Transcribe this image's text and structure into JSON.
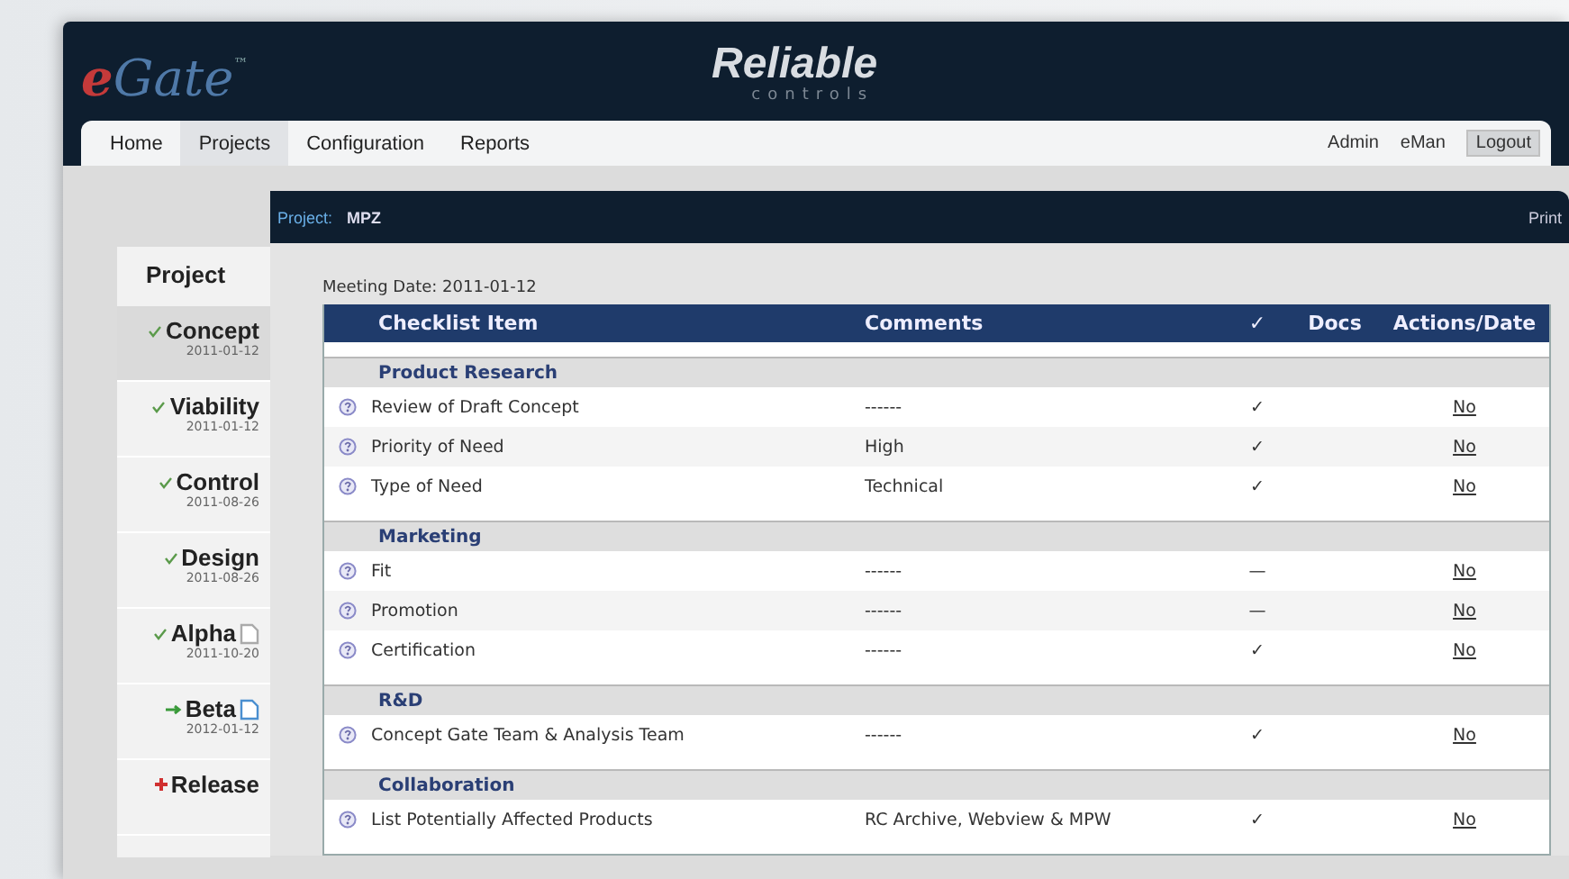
{
  "logo": {
    "mark": "e",
    "name": "Gate",
    "tm": "™"
  },
  "brand": {
    "name": "Reliable",
    "sub": "controls"
  },
  "nav": [
    {
      "label": "Home",
      "selected": false
    },
    {
      "label": "Projects",
      "selected": true
    },
    {
      "label": "Configuration",
      "selected": false
    },
    {
      "label": "Reports",
      "selected": false
    }
  ],
  "user_links": [
    {
      "label": "Admin",
      "kind": "link"
    },
    {
      "label": "eMan",
      "kind": "link"
    },
    {
      "label": "Logout",
      "kind": "button"
    }
  ],
  "sidebar": {
    "title": "Project",
    "stages": [
      {
        "name": "Concept",
        "date": "2011-01-12",
        "kind": "done",
        "attached": false,
        "linked": false,
        "selected": true
      },
      {
        "name": "Viability",
        "date": "2011-01-12",
        "kind": "done",
        "attached": false,
        "linked": false,
        "selected": false
      },
      {
        "name": "Control",
        "date": "2011-08-26",
        "kind": "done",
        "attached": false,
        "linked": false,
        "selected": false
      },
      {
        "name": "Design",
        "date": "2011-08-26",
        "kind": "done",
        "attached": false,
        "linked": false,
        "selected": false
      },
      {
        "name": "Alpha",
        "date": "2011-10-20",
        "kind": "done",
        "attached": true,
        "linked": false,
        "selected": false
      },
      {
        "name": "Beta",
        "date": "2012-01-12",
        "kind": "current",
        "attached": true,
        "linked": true,
        "selected": false
      },
      {
        "name": "Release",
        "kind": "pending",
        "attached": false,
        "linked": false,
        "selected": false
      }
    ]
  },
  "panel": {
    "project_label": "Project:",
    "project_name": "MPZ",
    "print": "Print",
    "meeting_date": "Meeting Date: 2011-01-12"
  },
  "table": {
    "columns": [
      "Checklist Item",
      "Comments",
      "✓",
      "Docs",
      "Actions/Date"
    ],
    "groups": [
      {
        "title": "Product Research",
        "rows": [
          {
            "item": "Review of Draft Concept",
            "comment": "------",
            "check": "✓",
            "action": "No"
          },
          {
            "item": "Priority of Need",
            "comment": "High",
            "check": "✓",
            "action": "No"
          },
          {
            "item": "Type of Need",
            "comment": "Technical",
            "check": "✓",
            "action": "No"
          }
        ]
      },
      {
        "title": "Marketing",
        "rows": [
          {
            "item": "Fit",
            "comment": "------",
            "check": "—",
            "action": "No"
          },
          {
            "item": "Promotion",
            "comment": "------",
            "check": "—",
            "action": "No"
          },
          {
            "item": "Certification",
            "comment": "------",
            "check": "✓",
            "action": "No"
          }
        ]
      },
      {
        "title": "R&D",
        "rows": [
          {
            "item": "Concept Gate Team & Analysis Team",
            "comment": "------",
            "check": "✓",
            "action": "No"
          }
        ]
      },
      {
        "title": "Collaboration",
        "rows": [
          {
            "item": "List Potentially Affected Products",
            "comment": "RC Archive, Webview & MPW",
            "check": "✓",
            "action": "No"
          }
        ]
      }
    ]
  }
}
